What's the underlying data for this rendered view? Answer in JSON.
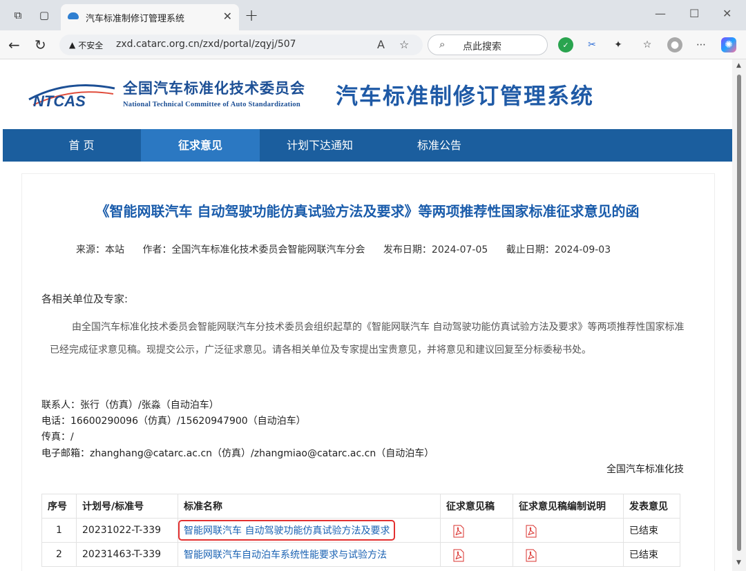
{
  "browser": {
    "tab_title": "汽车标准制修订管理系统",
    "insecure_label": "不安全",
    "url": "zxd.catarc.org.cn/zxd/portal/zqyj/507",
    "search_placeholder": "点此搜索"
  },
  "header": {
    "logo_text": "NTCAS",
    "org_cn": "全国汽车标准化技术委员会",
    "org_en": "National Technical Committee of Auto Standardization",
    "system_title": "汽车标准制修订管理系统"
  },
  "nav": {
    "items": [
      {
        "label": "首 页"
      },
      {
        "label": "征求意见"
      },
      {
        "label": "计划下达通知"
      },
      {
        "label": "标准公告"
      }
    ]
  },
  "article": {
    "title": "《智能网联汽车 自动驾驶功能仿真试验方法及要求》等两项推荐性国家标准征求意见的函",
    "source": "来源：本站",
    "author": "作者：全国汽车标准化技术委员会智能网联汽车分会",
    "publish_date": "发布日期：2024-07-05",
    "deadline": "截止日期：2024-09-03",
    "salutation": "各相关单位及专家:",
    "body": "由全国汽车标准化技术委员会智能网联汽车分技术委员会组织起草的《智能网联汽车 自动驾驶功能仿真试验方法及要求》等两项推荐性国家标准已经完成征求意见稿。现提交公示，广泛征求意见。请各相关单位及专家提出宝贵意见，并将意见和建议回复至分标委秘书处。",
    "contact_person": "联系人：张行（仿真）/张淼（自动泊车）",
    "phone": "电话：16600290096（仿真）/15620947900（自动泊车）",
    "fax": "传真：/",
    "email": "电子邮箱：zhanghang@catarc.ac.cn（仿真）/zhangmiao@catarc.ac.cn（自动泊车）",
    "signoff": "全国汽车标准化技"
  },
  "table": {
    "headers": [
      "序号",
      "计划号/标准号",
      "标准名称",
      "征求意见稿",
      "征求意见稿编制说明",
      "发表意见"
    ],
    "rows": [
      {
        "no": "1",
        "plan": "20231022-T-339",
        "name": "智能网联汽车 自动驾驶功能仿真试验方法及要求",
        "status": "已结束"
      },
      {
        "no": "2",
        "plan": "20231463-T-339",
        "name": "智能网联汽车自动泊车系统性能要求与试验方法",
        "status": "已结束"
      }
    ]
  },
  "colors": {
    "nav_bg": "#1b5e9e",
    "nav_active": "#2b78c2",
    "title_blue": "#1a5cab",
    "link_blue": "#1a62b3",
    "highlight_red": "#e33030"
  }
}
